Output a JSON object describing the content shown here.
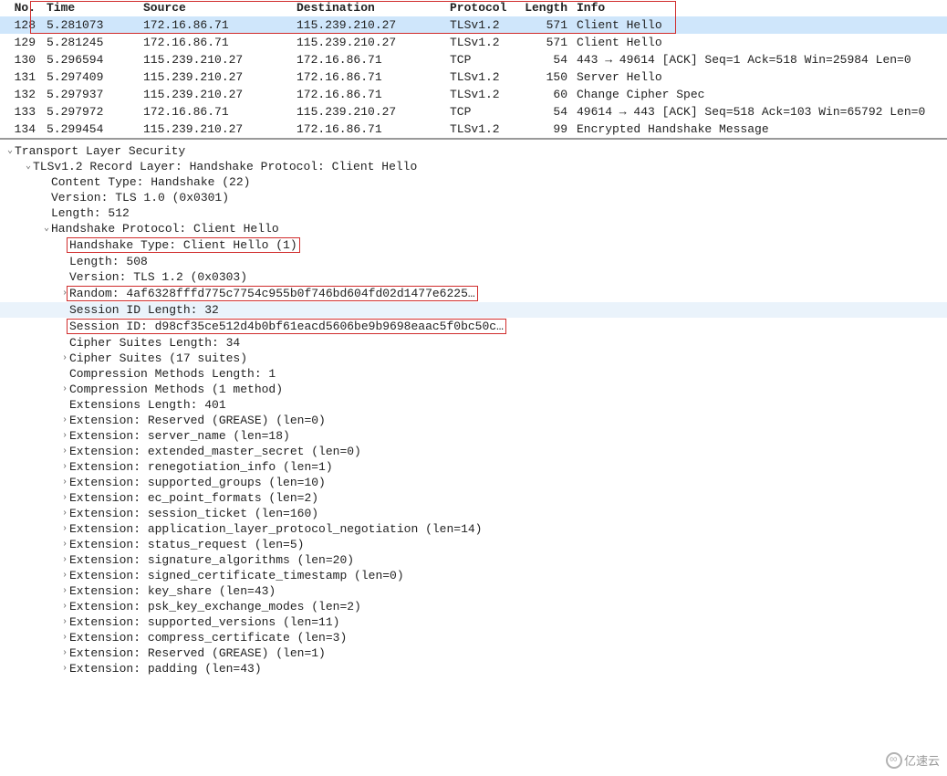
{
  "columns": {
    "no": "No.",
    "time": "Time",
    "source": "Source",
    "destination": "Destination",
    "protocol": "Protocol",
    "length": "Length",
    "info": "Info"
  },
  "packets": [
    {
      "no": "128",
      "time": "5.281073",
      "src": "172.16.86.71",
      "dst": "115.239.210.27",
      "proto": "TLSv1.2",
      "len": "571",
      "info": "Client Hello",
      "selected": true
    },
    {
      "no": "129",
      "time": "5.281245",
      "src": "172.16.86.71",
      "dst": "115.239.210.27",
      "proto": "TLSv1.2",
      "len": "571",
      "info": "Client Hello"
    },
    {
      "no": "130",
      "time": "5.296594",
      "src": "115.239.210.27",
      "dst": "172.16.86.71",
      "proto": "TCP",
      "len": "54",
      "info": "443 → 49614 [ACK] Seq=1 Ack=518 Win=25984 Len=0"
    },
    {
      "no": "131",
      "time": "5.297409",
      "src": "115.239.210.27",
      "dst": "172.16.86.71",
      "proto": "TLSv1.2",
      "len": "150",
      "info": "Server Hello"
    },
    {
      "no": "132",
      "time": "5.297937",
      "src": "115.239.210.27",
      "dst": "172.16.86.71",
      "proto": "TLSv1.2",
      "len": "60",
      "info": "Change Cipher Spec"
    },
    {
      "no": "133",
      "time": "5.297972",
      "src": "172.16.86.71",
      "dst": "115.239.210.27",
      "proto": "TCP",
      "len": "54",
      "info": "49614 → 443 [ACK] Seq=518 Ack=103 Win=65792 Len=0"
    },
    {
      "no": "134",
      "time": "5.299454",
      "src": "115.239.210.27",
      "dst": "172.16.86.71",
      "proto": "TLSv1.2",
      "len": "99",
      "info": "Encrypted Handshake Message"
    }
  ],
  "tree": [
    {
      "indent": 0,
      "caret": "open",
      "text": "Transport Layer Security"
    },
    {
      "indent": 1,
      "caret": "open",
      "text": "TLSv1.2 Record Layer: Handshake Protocol: Client Hello"
    },
    {
      "indent": 2,
      "caret": "none",
      "text": "Content Type: Handshake (22)"
    },
    {
      "indent": 2,
      "caret": "none",
      "text": "Version: TLS 1.0 (0x0301)"
    },
    {
      "indent": 2,
      "caret": "none",
      "text": "Length: 512"
    },
    {
      "indent": 2,
      "caret": "open",
      "text": "Handshake Protocol: Client Hello"
    },
    {
      "indent": 3,
      "caret": "none",
      "text": "Handshake Type: Client Hello (1)",
      "redbox": true
    },
    {
      "indent": 3,
      "caret": "none",
      "text": "Length: 508"
    },
    {
      "indent": 3,
      "caret": "none",
      "text": "Version: TLS 1.2 (0x0303)"
    },
    {
      "indent": 3,
      "caret": "closed",
      "text": "Random: 4af6328fffd775c7754c955b0f746bd604fd02d1477e6225…",
      "redbox": true
    },
    {
      "indent": 3,
      "caret": "none",
      "text": "Session ID Length: 32",
      "hov": true
    },
    {
      "indent": 3,
      "caret": "none",
      "text": "Session ID: d98cf35ce512d4b0bf61eacd5606be9b9698eaac5f0bc50c…",
      "redbox": true
    },
    {
      "indent": 3,
      "caret": "none",
      "text": "Cipher Suites Length: 34"
    },
    {
      "indent": 3,
      "caret": "closed",
      "text": "Cipher Suites (17 suites)"
    },
    {
      "indent": 3,
      "caret": "none",
      "text": "Compression Methods Length: 1"
    },
    {
      "indent": 3,
      "caret": "closed",
      "text": "Compression Methods (1 method)"
    },
    {
      "indent": 3,
      "caret": "none",
      "text": "Extensions Length: 401"
    },
    {
      "indent": 3,
      "caret": "closed",
      "text": "Extension: Reserved (GREASE) (len=0)"
    },
    {
      "indent": 3,
      "caret": "closed",
      "text": "Extension: server_name (len=18)"
    },
    {
      "indent": 3,
      "caret": "closed",
      "text": "Extension: extended_master_secret (len=0)"
    },
    {
      "indent": 3,
      "caret": "closed",
      "text": "Extension: renegotiation_info (len=1)"
    },
    {
      "indent": 3,
      "caret": "closed",
      "text": "Extension: supported_groups (len=10)"
    },
    {
      "indent": 3,
      "caret": "closed",
      "text": "Extension: ec_point_formats (len=2)"
    },
    {
      "indent": 3,
      "caret": "closed",
      "text": "Extension: session_ticket (len=160)"
    },
    {
      "indent": 3,
      "caret": "closed",
      "text": "Extension: application_layer_protocol_negotiation (len=14)"
    },
    {
      "indent": 3,
      "caret": "closed",
      "text": "Extension: status_request (len=5)"
    },
    {
      "indent": 3,
      "caret": "closed",
      "text": "Extension: signature_algorithms (len=20)"
    },
    {
      "indent": 3,
      "caret": "closed",
      "text": "Extension: signed_certificate_timestamp (len=0)"
    },
    {
      "indent": 3,
      "caret": "closed",
      "text": "Extension: key_share (len=43)"
    },
    {
      "indent": 3,
      "caret": "closed",
      "text": "Extension: psk_key_exchange_modes (len=2)"
    },
    {
      "indent": 3,
      "caret": "closed",
      "text": "Extension: supported_versions (len=11)"
    },
    {
      "indent": 3,
      "caret": "closed",
      "text": "Extension: compress_certificate (len=3)"
    },
    {
      "indent": 3,
      "caret": "closed",
      "text": "Extension: Reserved (GREASE) (len=1)"
    },
    {
      "indent": 3,
      "caret": "closed",
      "text": "Extension: padding (len=43)"
    }
  ],
  "watermark": "亿速云"
}
